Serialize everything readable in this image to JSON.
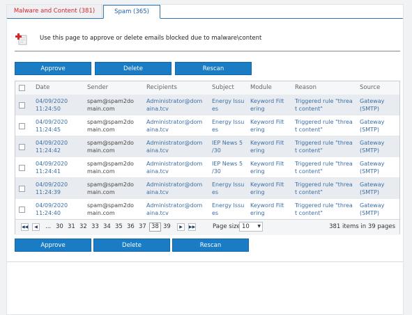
{
  "tabs": [
    {
      "label": "Malware and Content (381)"
    },
    {
      "label": "Spam (365)"
    }
  ],
  "info": {
    "text": "Use this page to approve or delete emails blocked due to malware\\content"
  },
  "buttons": {
    "approve": "Approve",
    "delete": "Delete",
    "rescan": "Rescan"
  },
  "columns": [
    "Date",
    "Sender",
    "Recipients",
    "Subject",
    "Module",
    "Reason",
    "Source"
  ],
  "rows": [
    {
      "date": "04/09/2020\n11:24:50",
      "sender": "spam@spam2do\nmain.com",
      "recipients": "Administrator@dom\naina.tcv",
      "subject": "Energy Issu\nes",
      "module": "Keyword Filt\nering",
      "reason": "Triggered rule \"threa\nt content\"",
      "source": "Gateway\n(SMTP)"
    },
    {
      "date": "04/09/2020\n11:24:45",
      "sender": "spam@spam2do\nmain.com",
      "recipients": "Administrator@dom\naina.tcv",
      "subject": "Energy Issu\nes",
      "module": "Keyword Filt\nering",
      "reason": "Triggered rule \"threa\nt content\"",
      "source": "Gateway\n(SMTP)"
    },
    {
      "date": "04/09/2020\n11:24:42",
      "sender": "spam@spam2do\nmain.com",
      "recipients": "Administrator@dom\naina.tcv",
      "subject": "IEP News 5\n/30",
      "module": "Keyword Filt\nering",
      "reason": "Triggered rule \"threa\nt content\"",
      "source": "Gateway\n(SMTP)"
    },
    {
      "date": "04/09/2020\n11:24:41",
      "sender": "spam@spam2do\nmain.com",
      "recipients": "Administrator@dom\naina.tcv",
      "subject": "IEP News 5\n/30",
      "module": "Keyword Filt\nering",
      "reason": "Triggered rule \"threa\nt content\"",
      "source": "Gateway\n(SMTP)"
    },
    {
      "date": "04/09/2020\n11:24:39",
      "sender": "spam@spam2do\nmain.com",
      "recipients": "Administrator@dom\naina.tcv",
      "subject": "Energy Issu\nes",
      "module": "Keyword Filt\nering",
      "reason": "Triggered rule \"threa\nt content\"",
      "source": "Gateway\n(SMTP)"
    },
    {
      "date": "04/09/2020\n11:24:40",
      "sender": "spam@spam2do\nmain.com",
      "recipients": "Administrator@dom\naina.tcv",
      "subject": "Energy Issu\nes",
      "module": "Keyword Filt\nering",
      "reason": "Triggered rule \"threa\nt content\"",
      "source": "Gateway\n(SMTP)"
    }
  ],
  "pager": {
    "ellipsis": "...",
    "pages": [
      "30",
      "31",
      "32",
      "33",
      "34",
      "35",
      "36",
      "37",
      "38",
      "39"
    ],
    "current": "38",
    "page_size_label": "Page size:",
    "page_size": "10",
    "items_text": "381 items in 39 pages",
    "first_icon": "first-page-icon",
    "prev_icon": "prev-page-icon",
    "next_icon": "next-page-icon",
    "last_icon": "last-page-icon"
  },
  "colors": {
    "accent": "#1a7cc4",
    "tab_active_text": "#d8242a",
    "link": "#3b6ea5"
  }
}
